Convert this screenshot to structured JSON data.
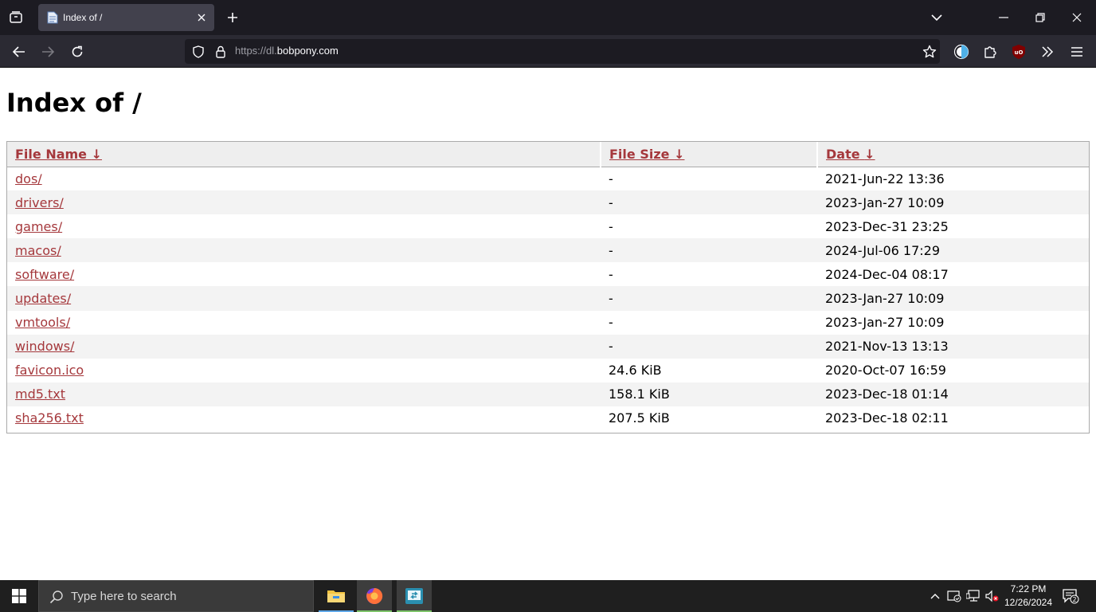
{
  "browser": {
    "tab_title": "Index of /",
    "url_prefix": "https://dl.",
    "url_domain": "bobpony.com"
  },
  "page": {
    "heading": "Index of /",
    "columns": {
      "name": "File Name",
      "size": "File Size",
      "date": "Date",
      "sort_arrow": "↓"
    },
    "rows": [
      {
        "name": "dos/",
        "size": "-",
        "date": "2021-Jun-22 13:36"
      },
      {
        "name": "drivers/",
        "size": "-",
        "date": "2023-Jan-27 10:09"
      },
      {
        "name": "games/",
        "size": "-",
        "date": "2023-Dec-31 23:25"
      },
      {
        "name": "macos/",
        "size": "-",
        "date": "2024-Jul-06 17:29"
      },
      {
        "name": "software/",
        "size": "-",
        "date": "2024-Dec-04 08:17"
      },
      {
        "name": "updates/",
        "size": "-",
        "date": "2023-Jan-27 10:09"
      },
      {
        "name": "vmtools/",
        "size": "-",
        "date": "2023-Jan-27 10:09"
      },
      {
        "name": "windows/",
        "size": "-",
        "date": "2021-Nov-13 13:13"
      },
      {
        "name": "favicon.ico",
        "size": "24.6 KiB",
        "date": "2020-Oct-07 16:59"
      },
      {
        "name": "md5.txt",
        "size": "158.1 KiB",
        "date": "2023-Dec-18 01:14"
      },
      {
        "name": "sha256.txt",
        "size": "207.5 KiB",
        "date": "2023-Dec-18 02:11"
      }
    ]
  },
  "taskbar": {
    "search_placeholder": "Type here to search",
    "time": "7:22 PM",
    "date": "12/26/2024",
    "notification_count": "2"
  },
  "icons": {
    "tab_list": "tab-list-icon",
    "favicon": "document-favicon-icon",
    "back": "back-arrow-icon",
    "forward": "forward-arrow-icon",
    "reload": "reload-icon",
    "shield": "tracking-shield-icon",
    "lock": "lock-icon",
    "bookmark": "star-icon",
    "dark_reader": "dark-reader-icon",
    "extensions": "puzzle-icon",
    "ublock": "ublock-origin-icon",
    "overflow": "chevron-double-right-icon",
    "menu": "hamburger-menu-icon"
  },
  "colors": {
    "link": "#a5383c",
    "tabbar_bg": "#1c1b22",
    "navbar_bg": "#2b2a33",
    "taskbar_bg": "#1f1f1f"
  }
}
